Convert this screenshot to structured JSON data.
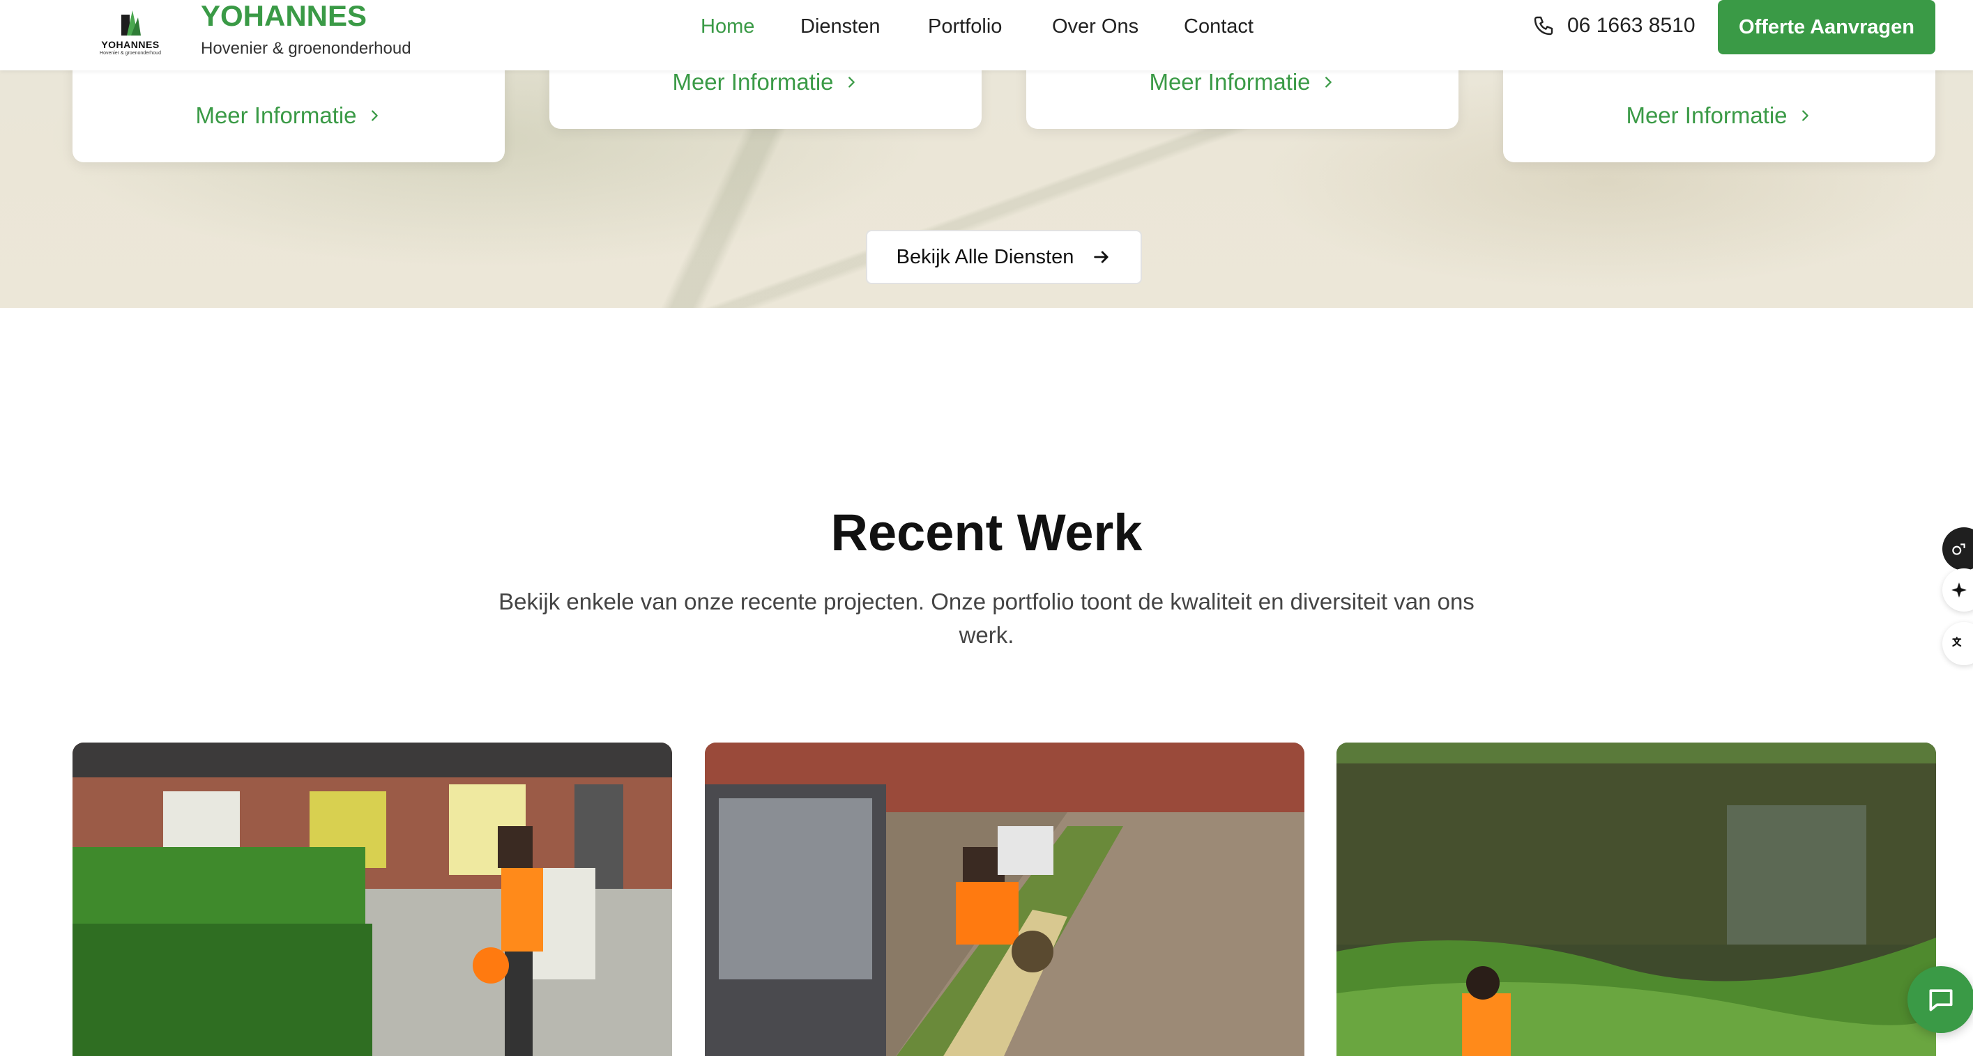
{
  "header": {
    "logo_word": "YOHANNES",
    "logo_tag": "Hovenier & groenonderhoud",
    "brand_name": "YOHANNES",
    "brand_sub": "Hovenier & groenonderhoud",
    "nav": [
      "Home",
      "Diensten",
      "Portfolio",
      "Over Ons",
      "Contact"
    ],
    "active_nav": "Home",
    "phone": "06 1663 8510",
    "cta": "Offerte Aanvragen"
  },
  "services": {
    "cards": [
      {
        "link": "Meer Informatie"
      },
      {
        "link": "Meer Informatie"
      },
      {
        "link": "Meer Informatie"
      },
      {
        "link": "Meer Informatie"
      }
    ],
    "all_button": "Bekijk Alle Diensten"
  },
  "recent": {
    "title": "Recent Werk",
    "subtitle": "Bekijk enkele van onze recente projecten. Onze portfolio toont de kwaliteit en diversiteit van ons werk."
  },
  "colors": {
    "accent": "#3a9a46",
    "text": "#111111"
  },
  "icons": {
    "phone": "phone-icon",
    "chevron": "chevron-right-icon",
    "arrow": "arrow-right-icon",
    "chat": "chat-icon"
  }
}
